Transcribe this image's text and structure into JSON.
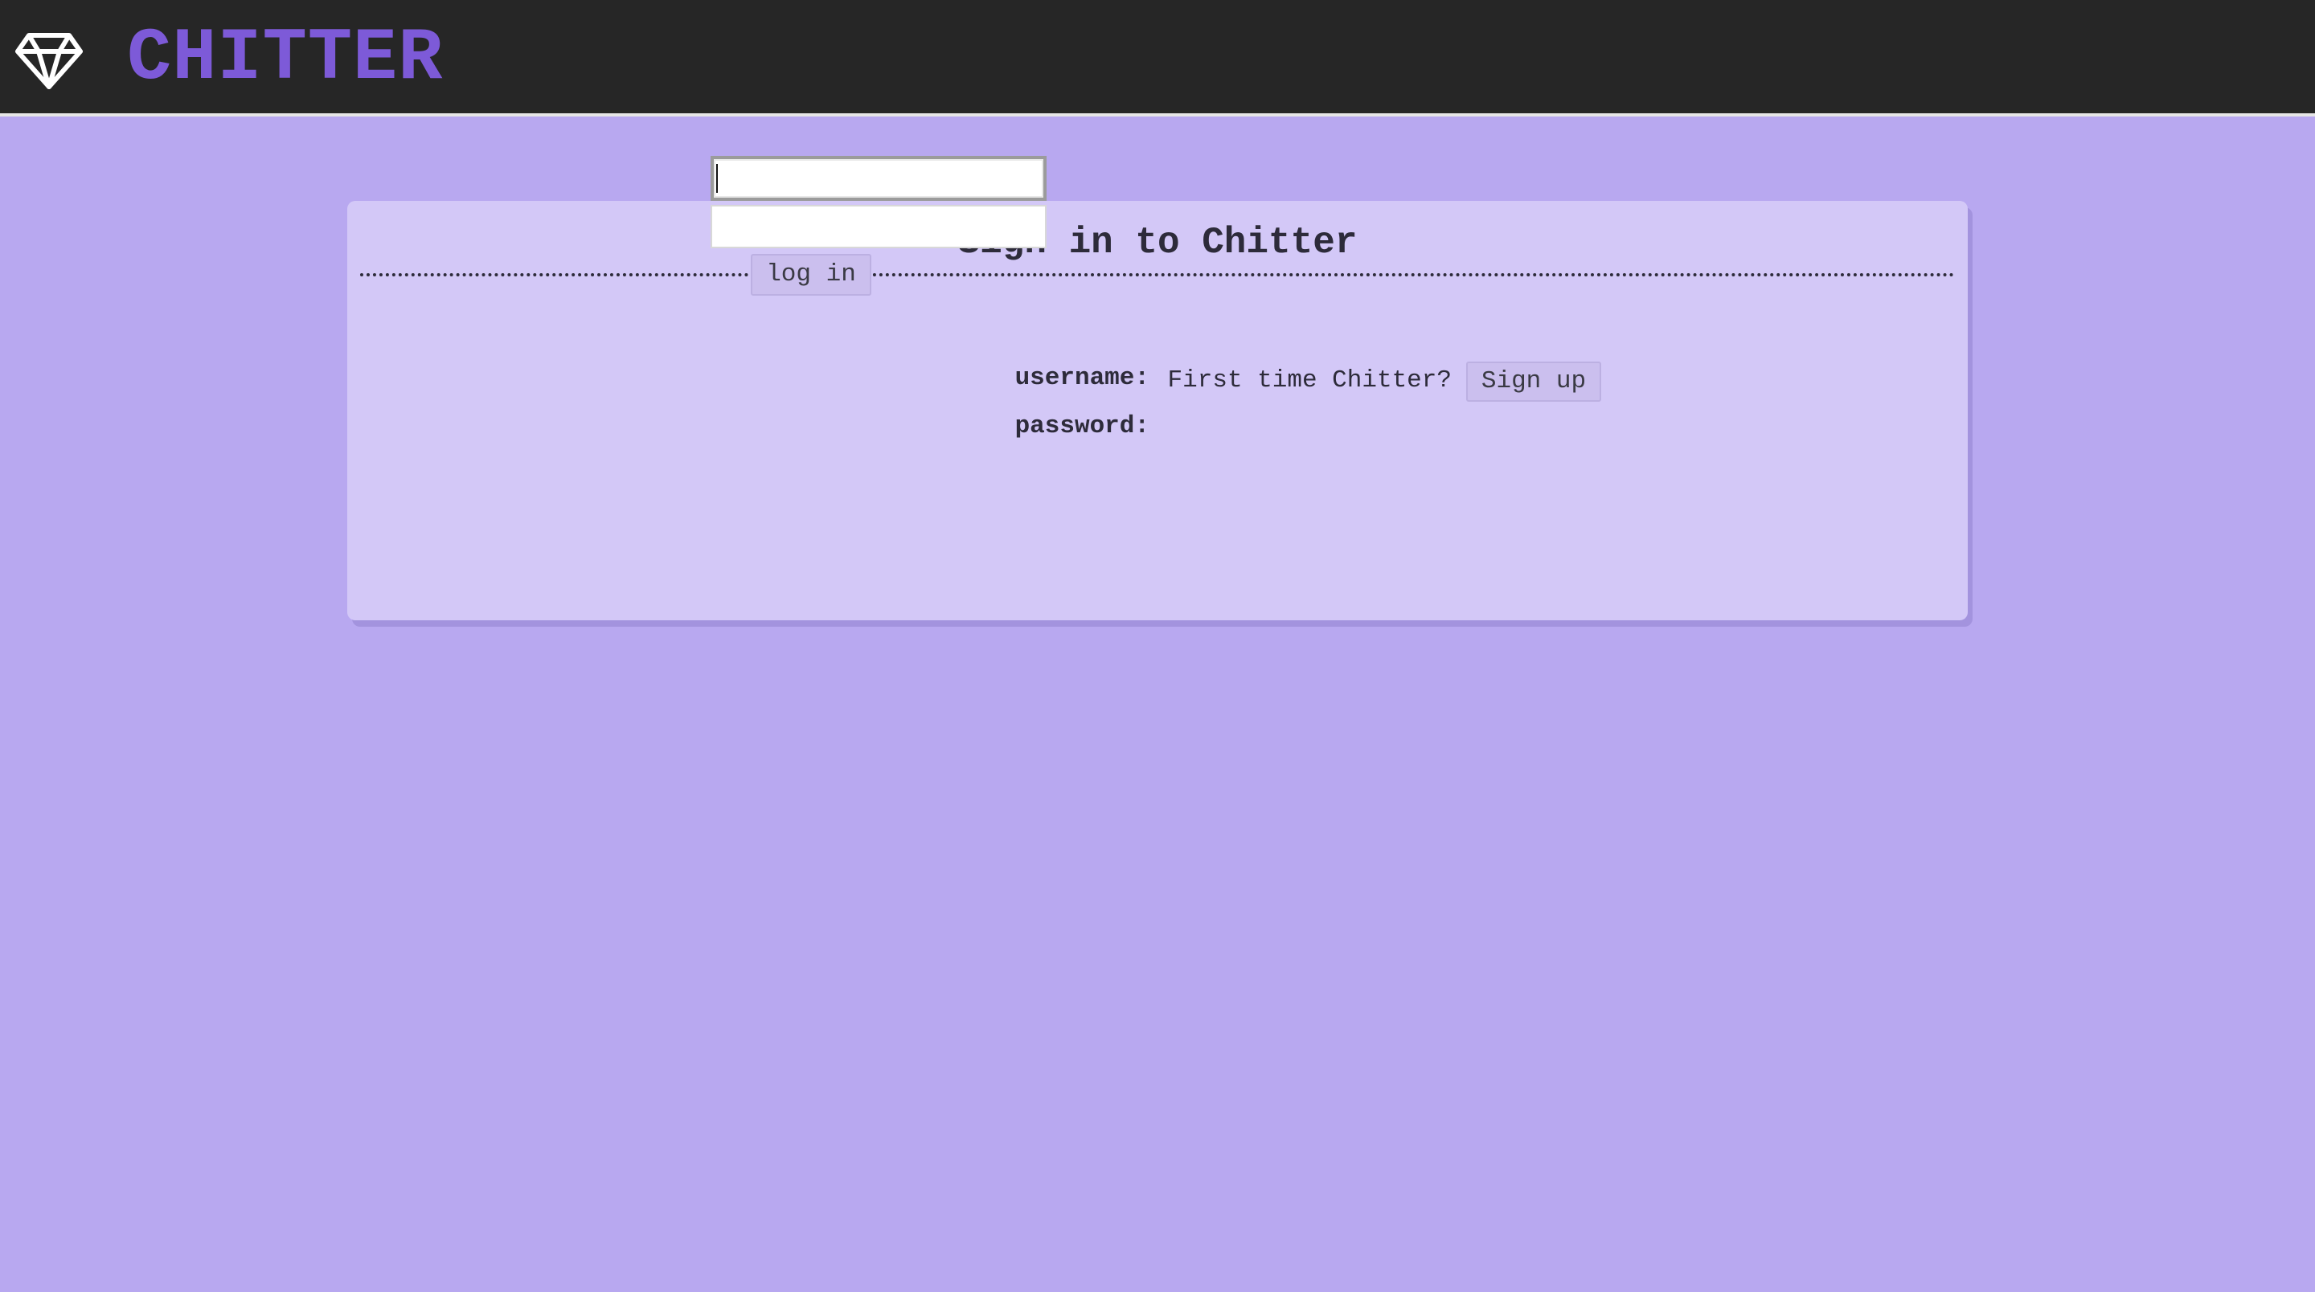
{
  "header": {
    "brand": "CHITTER",
    "logo_icon": "diamond-icon",
    "background": "#262626",
    "brand_color": "#7d5ad8"
  },
  "page": {
    "background": "#b8a8f0"
  },
  "login": {
    "title": "Sign in to Chitter",
    "username_label": "username:",
    "username_value": "",
    "password_label": "password:",
    "password_value": "",
    "submit_label": "log in",
    "signup_prompt": "First time Chitter?",
    "signup_label": "Sign up",
    "panel_color": "#d3c8f7"
  }
}
